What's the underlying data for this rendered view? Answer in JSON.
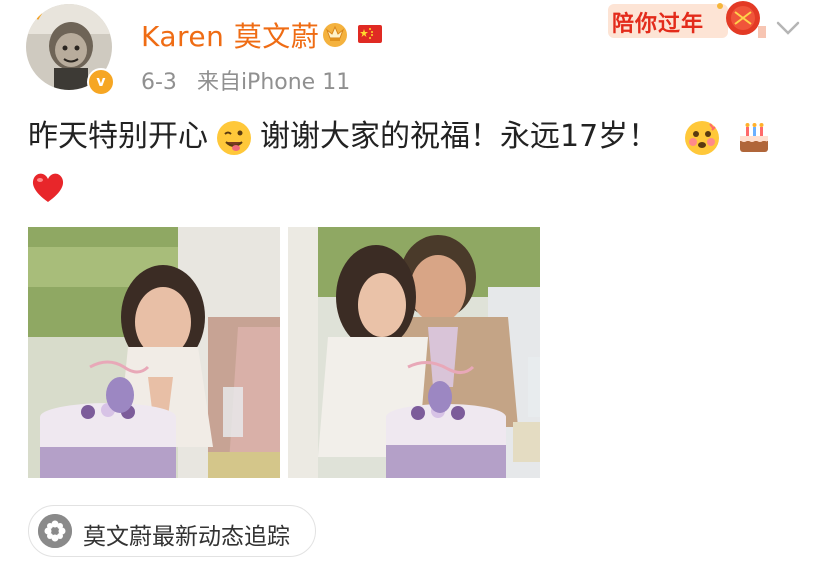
{
  "user": {
    "name": "Karen 莫文蔚"
  },
  "post_meta": {
    "date": "6-3",
    "source": "来自iPhone 11"
  },
  "banner": {
    "text": "陪你过年"
  },
  "post": {
    "text_part1": "昨天特别开心",
    "text_part2": "谢谢大家的祝福！永远17岁！"
  },
  "topic": {
    "label": "莫文蔚最新动态追踪"
  },
  "colors": {
    "username": "#ef6c14",
    "meta": "#909090",
    "banner": "#e32b1b"
  }
}
